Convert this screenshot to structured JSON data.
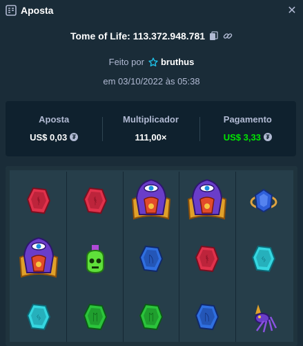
{
  "header": {
    "title": "Aposta",
    "close": "✕"
  },
  "game": {
    "name": "Tome of Life: 113.372.948.781"
  },
  "made_by": {
    "prefix": "Feito por",
    "user": "bruthus"
  },
  "date": "em 03/10/2022 às 05:38",
  "stats": {
    "bet_label": "Aposta",
    "bet_value": "US$ 0,03",
    "mult_label": "Multiplicador",
    "mult_value": "111,00×",
    "payout_label": "Pagamento",
    "payout_value": "US$ 3,33"
  },
  "colors": {
    "bg": "#1a2c38",
    "panel": "#0f212e",
    "muted": "#b1bad3",
    "green": "#00e701"
  },
  "reels": [
    [
      "red-gem",
      "red-gem",
      "tome-wizard",
      "tome-wizard",
      "blue-orb"
    ],
    [
      "tome-wizard",
      "green-potion-skull",
      "blue-gem",
      "red-gem",
      "cyan-gem"
    ],
    [
      "cyan-gem",
      "green-gem",
      "green-gem",
      "blue-gem",
      "purple-spider"
    ]
  ]
}
